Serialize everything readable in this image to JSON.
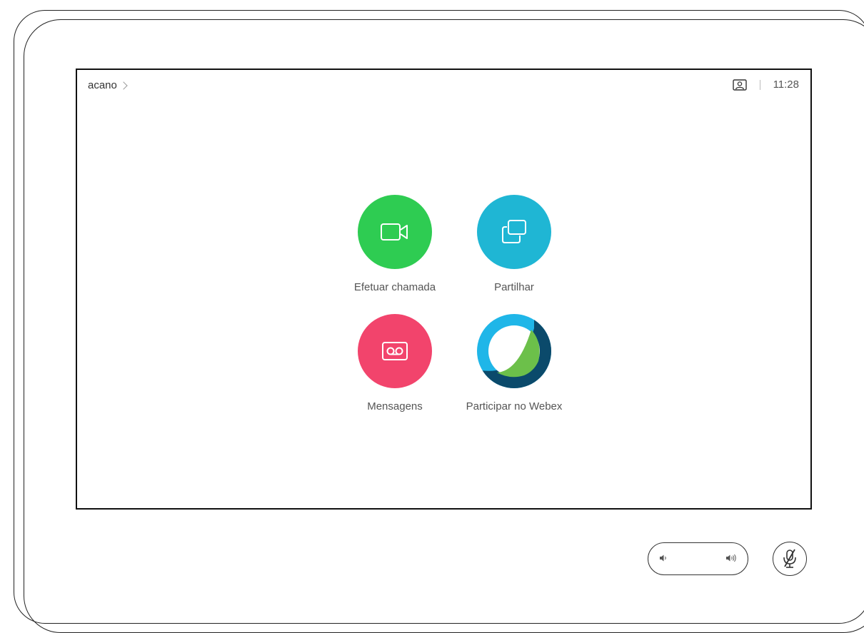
{
  "header": {
    "system_name": "acano",
    "time": "11:28"
  },
  "apps": [
    {
      "label": "Efetuar chamada",
      "color": "#2ecc52",
      "icon": "video-camera-icon"
    },
    {
      "label": "Partilhar",
      "color": "#1fb6d4",
      "icon": "share-screen-icon"
    },
    {
      "label": "Mensagens",
      "color": "#f2446c",
      "icon": "voicemail-icon"
    },
    {
      "label": "Participar no Webex",
      "color": "#ffffff",
      "icon": "webex-logo-icon"
    }
  ],
  "controls": {
    "volume": "volume-control",
    "mute": "microphone-muted"
  },
  "colors": {
    "webex_cyan": "#1fb6e8",
    "webex_green": "#6cc04a",
    "webex_navy": "#0b4a6b"
  }
}
